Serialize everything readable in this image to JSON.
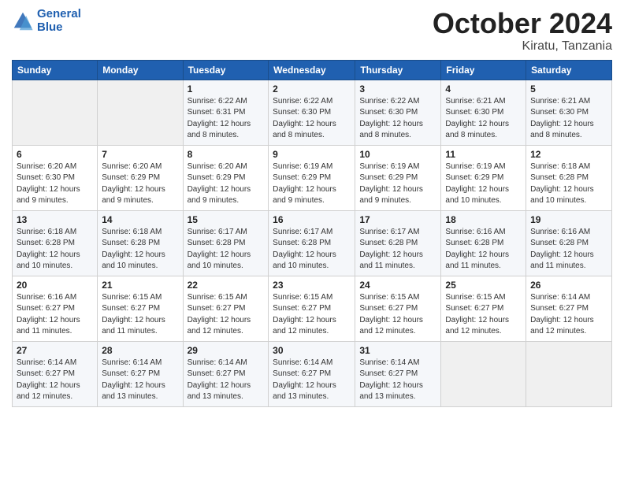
{
  "header": {
    "logo_line1": "General",
    "logo_line2": "Blue",
    "month_title": "October 2024",
    "location": "Kiratu, Tanzania"
  },
  "weekdays": [
    "Sunday",
    "Monday",
    "Tuesday",
    "Wednesday",
    "Thursday",
    "Friday",
    "Saturday"
  ],
  "weeks": [
    [
      null,
      null,
      {
        "day": 1,
        "sunrise": "6:22 AM",
        "sunset": "6:31 PM",
        "daylight": "12 hours and 8 minutes."
      },
      {
        "day": 2,
        "sunrise": "6:22 AM",
        "sunset": "6:30 PM",
        "daylight": "12 hours and 8 minutes."
      },
      {
        "day": 3,
        "sunrise": "6:22 AM",
        "sunset": "6:30 PM",
        "daylight": "12 hours and 8 minutes."
      },
      {
        "day": 4,
        "sunrise": "6:21 AM",
        "sunset": "6:30 PM",
        "daylight": "12 hours and 8 minutes."
      },
      {
        "day": 5,
        "sunrise": "6:21 AM",
        "sunset": "6:30 PM",
        "daylight": "12 hours and 8 minutes."
      }
    ],
    [
      {
        "day": 6,
        "sunrise": "6:20 AM",
        "sunset": "6:30 PM",
        "daylight": "12 hours and 9 minutes."
      },
      {
        "day": 7,
        "sunrise": "6:20 AM",
        "sunset": "6:29 PM",
        "daylight": "12 hours and 9 minutes."
      },
      {
        "day": 8,
        "sunrise": "6:20 AM",
        "sunset": "6:29 PM",
        "daylight": "12 hours and 9 minutes."
      },
      {
        "day": 9,
        "sunrise": "6:19 AM",
        "sunset": "6:29 PM",
        "daylight": "12 hours and 9 minutes."
      },
      {
        "day": 10,
        "sunrise": "6:19 AM",
        "sunset": "6:29 PM",
        "daylight": "12 hours and 9 minutes."
      },
      {
        "day": 11,
        "sunrise": "6:19 AM",
        "sunset": "6:29 PM",
        "daylight": "12 hours and 10 minutes."
      },
      {
        "day": 12,
        "sunrise": "6:18 AM",
        "sunset": "6:28 PM",
        "daylight": "12 hours and 10 minutes."
      }
    ],
    [
      {
        "day": 13,
        "sunrise": "6:18 AM",
        "sunset": "6:28 PM",
        "daylight": "12 hours and 10 minutes."
      },
      {
        "day": 14,
        "sunrise": "6:18 AM",
        "sunset": "6:28 PM",
        "daylight": "12 hours and 10 minutes."
      },
      {
        "day": 15,
        "sunrise": "6:17 AM",
        "sunset": "6:28 PM",
        "daylight": "12 hours and 10 minutes."
      },
      {
        "day": 16,
        "sunrise": "6:17 AM",
        "sunset": "6:28 PM",
        "daylight": "12 hours and 10 minutes."
      },
      {
        "day": 17,
        "sunrise": "6:17 AM",
        "sunset": "6:28 PM",
        "daylight": "12 hours and 11 minutes."
      },
      {
        "day": 18,
        "sunrise": "6:16 AM",
        "sunset": "6:28 PM",
        "daylight": "12 hours and 11 minutes."
      },
      {
        "day": 19,
        "sunrise": "6:16 AM",
        "sunset": "6:28 PM",
        "daylight": "12 hours and 11 minutes."
      }
    ],
    [
      {
        "day": 20,
        "sunrise": "6:16 AM",
        "sunset": "6:27 PM",
        "daylight": "12 hours and 11 minutes."
      },
      {
        "day": 21,
        "sunrise": "6:15 AM",
        "sunset": "6:27 PM",
        "daylight": "12 hours and 11 minutes."
      },
      {
        "day": 22,
        "sunrise": "6:15 AM",
        "sunset": "6:27 PM",
        "daylight": "12 hours and 12 minutes."
      },
      {
        "day": 23,
        "sunrise": "6:15 AM",
        "sunset": "6:27 PM",
        "daylight": "12 hours and 12 minutes."
      },
      {
        "day": 24,
        "sunrise": "6:15 AM",
        "sunset": "6:27 PM",
        "daylight": "12 hours and 12 minutes."
      },
      {
        "day": 25,
        "sunrise": "6:15 AM",
        "sunset": "6:27 PM",
        "daylight": "12 hours and 12 minutes."
      },
      {
        "day": 26,
        "sunrise": "6:14 AM",
        "sunset": "6:27 PM",
        "daylight": "12 hours and 12 minutes."
      }
    ],
    [
      {
        "day": 27,
        "sunrise": "6:14 AM",
        "sunset": "6:27 PM",
        "daylight": "12 hours and 12 minutes."
      },
      {
        "day": 28,
        "sunrise": "6:14 AM",
        "sunset": "6:27 PM",
        "daylight": "12 hours and 13 minutes."
      },
      {
        "day": 29,
        "sunrise": "6:14 AM",
        "sunset": "6:27 PM",
        "daylight": "12 hours and 13 minutes."
      },
      {
        "day": 30,
        "sunrise": "6:14 AM",
        "sunset": "6:27 PM",
        "daylight": "12 hours and 13 minutes."
      },
      {
        "day": 31,
        "sunrise": "6:14 AM",
        "sunset": "6:27 PM",
        "daylight": "12 hours and 13 minutes."
      },
      null,
      null
    ]
  ]
}
